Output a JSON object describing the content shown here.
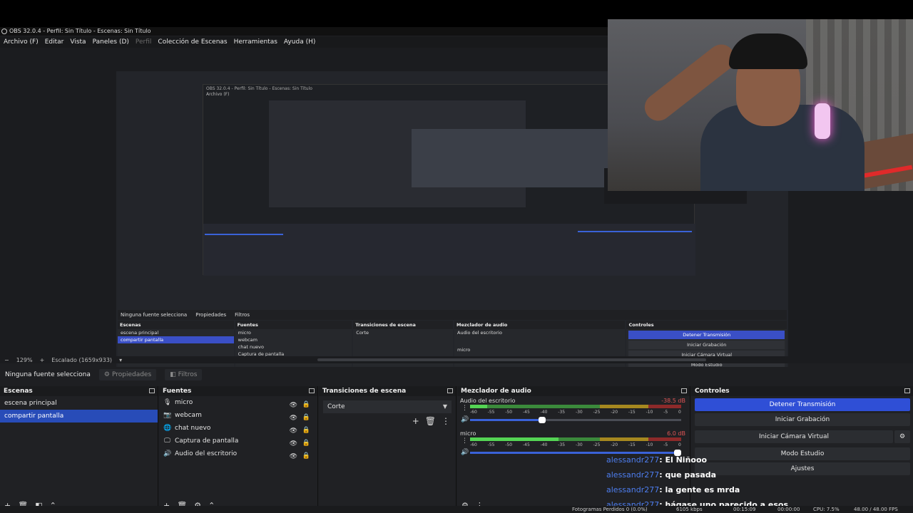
{
  "window": {
    "title": "OBS 32.0.4 - Perfil: Sin Título - Escenas: Sin Título"
  },
  "menu": [
    "Archivo (F)",
    "Editar",
    "Vista",
    "Paneles (D)",
    "Perfil",
    "Colección de Escenas",
    "Herramientas",
    "Ayuda (H)"
  ],
  "preview_footer": {
    "zoom": "129%",
    "scale": "Escalado (1659x933)"
  },
  "source_bar": {
    "none_selected": "Ninguna fuente selecciona",
    "properties": "Propiedades",
    "filters": "Filtros"
  },
  "scenes": {
    "title": "Escenas",
    "items": [
      {
        "label": "escena principal",
        "selected": false
      },
      {
        "label": "compartir pantalla",
        "selected": true
      }
    ]
  },
  "sources": {
    "title": "Fuentes",
    "items": [
      {
        "label": "micro",
        "icon": "microphone-icon"
      },
      {
        "label": "webcam",
        "icon": "camera-icon"
      },
      {
        "label": "chat nuevo",
        "icon": "globe-icon"
      },
      {
        "label": "Captura de pantalla",
        "icon": "monitor-icon"
      },
      {
        "label": "Audio del escritorio",
        "icon": "speaker-icon"
      }
    ]
  },
  "transitions": {
    "title": "Transiciones de escena",
    "selected": "Corte"
  },
  "mixer": {
    "title": "Mezclador de audio",
    "channels": [
      {
        "name": "Audio del escritorio",
        "db": "-38.5 dB",
        "level": 0.08,
        "volume": 0.34
      },
      {
        "name": "micro",
        "db": "6.0 dB",
        "level": 0.42,
        "volume": 1.0
      }
    ],
    "ticks": [
      "-60",
      "-55",
      "-50",
      "-45",
      "-40",
      "-35",
      "-30",
      "-25",
      "-20",
      "-15",
      "-10",
      "-5",
      "0"
    ]
  },
  "controls": {
    "title": "Controles",
    "stop_stream": "Detener Transmisión",
    "start_recording": "Iniciar Grabación",
    "start_virtual_cam": "Iniciar Cámara Virtual",
    "studio_mode": "Modo Estudio",
    "settings": "Ajustes"
  },
  "chat": [
    {
      "user": "alessandr277",
      "text": ": El Niñooo"
    },
    {
      "user": "alessandr277",
      "text": ": que pasada"
    },
    {
      "user": "alessandr277",
      "text": ": la gente es mrda"
    },
    {
      "user": "alessandr277",
      "text": ": hágase uno parecido a esos"
    }
  ],
  "status": {
    "dropped": "Fotogramas Perdidos 0 (0.0%)",
    "bitrate": "6105 kbps",
    "stream_time": "00:15:09",
    "rec_time": "00:00:00",
    "cpu": "CPU: 7.5%",
    "fps": "48.00 / 48.00 FPS"
  },
  "colors": {
    "accent": "#2f4fd6",
    "selection": "#284cb8",
    "chat_user": "#4d7ef0"
  }
}
